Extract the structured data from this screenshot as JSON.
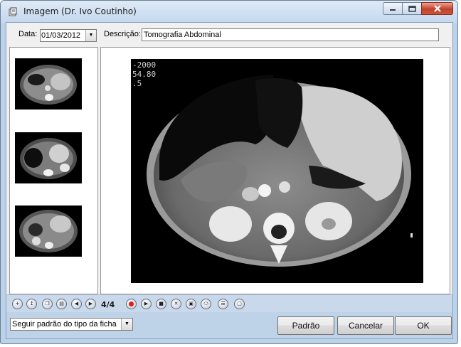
{
  "window": {
    "title": "Imagem (Dr. Ivo Coutinho)",
    "minimize_icon": "minimize-icon",
    "maximize_icon": "maximize-icon",
    "close_icon": "close-icon"
  },
  "form": {
    "date_label": "Data:",
    "date_value": "01/03/2012",
    "description_label": "Descrição:",
    "description_value": "Tomografia Abdominal"
  },
  "image": {
    "overlay_lines": [
      "-2000",
      "54.80",
      ".5"
    ]
  },
  "thumbnails": [
    {
      "name": "thumbnail-1"
    },
    {
      "name": "thumbnail-2"
    },
    {
      "name": "thumbnail-3"
    }
  ],
  "toolbar": {
    "counter": "4/4",
    "icons": [
      "add-image-icon",
      "import-image-icon",
      "copy-image-icon",
      "paste-image-icon",
      "previous-icon",
      "next-icon",
      "record-icon",
      "play-icon",
      "stop-icon",
      "delete-icon",
      "camera-icon",
      "scanner-icon",
      "properties-icon",
      "print-icon"
    ]
  },
  "footer": {
    "mode_value": "Seguir padrão do tipo da ficha",
    "padrao_label": "Padrão",
    "cancel_label": "Cancelar",
    "ok_label": "OK"
  },
  "colors": {
    "titlebar": "#c3d7ee",
    "toolbar": "#c9d9eb",
    "record": "#e11c1c",
    "close_button": "#c2412a"
  }
}
